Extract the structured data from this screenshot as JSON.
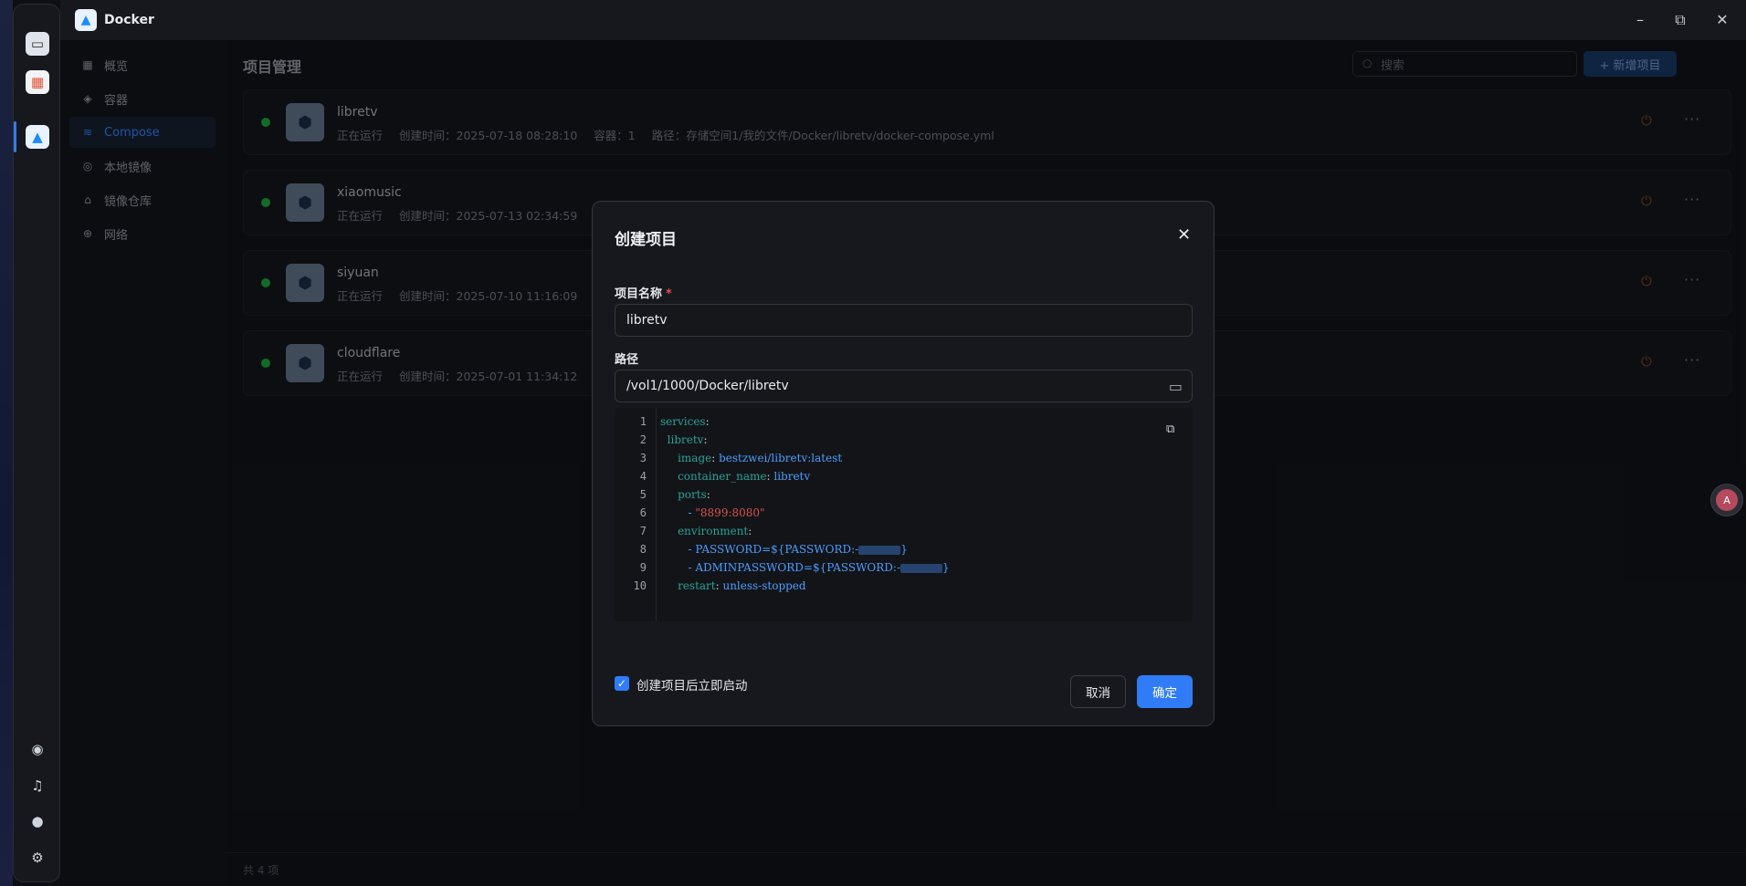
{
  "app": {
    "title": "Docker"
  },
  "window_controls": {
    "minimize": "–",
    "maximize": "⧉",
    "close": "✕"
  },
  "sidebar": {
    "items": [
      {
        "label": "概览",
        "icon": "grid-icon"
      },
      {
        "label": "容器",
        "icon": "box-icon"
      },
      {
        "label": "Compose",
        "icon": "layers-icon",
        "active": true
      },
      {
        "label": "本地镜像",
        "icon": "eye-icon"
      },
      {
        "label": "镜像仓库",
        "icon": "home-icon"
      },
      {
        "label": "网络",
        "icon": "globe-icon"
      }
    ]
  },
  "main": {
    "title": "项目管理",
    "search_placeholder": "搜索",
    "add_button": "+ 新增项目",
    "footer": "共 4 项",
    "projects": [
      {
        "name": "libretv",
        "status": "正在运行",
        "created": "创建时间：2025-07-18 08:28:10",
        "containers": "容器：1",
        "path": "路径：存储空间1/我的文件/Docker/libretv/docker-compose.yml"
      },
      {
        "name": "xiaomusic",
        "status": "正在运行",
        "created": "创建时间：2025-07-13 02:34:59"
      },
      {
        "name": "siyuan",
        "status": "正在运行",
        "created": "创建时间：2025-07-10 11:16:09"
      },
      {
        "name": "cloudflare",
        "status": "正在运行",
        "created": "创建时间：2025-07-01 11:34:12"
      }
    ]
  },
  "dialog": {
    "title": "创建项目",
    "name_label": "项目名称",
    "required_mark": "*",
    "name_value": "libretv",
    "path_label": "路径",
    "path_value": "/vol1/1000/Docker/libretv",
    "code_lines": [
      {
        "n": "1",
        "indent": "",
        "key": "services",
        "sep": ":",
        "val": ""
      },
      {
        "n": "2",
        "indent": "  ",
        "key": "libretv",
        "sep": ":",
        "val": ""
      },
      {
        "n": "3",
        "indent": "     ",
        "key": "image",
        "sep": ": ",
        "val": "bestzwei/libretv:latest"
      },
      {
        "n": "4",
        "indent": "     ",
        "key": "container_name",
        "sep": ": ",
        "val": "libretv"
      },
      {
        "n": "5",
        "indent": "     ",
        "key": "ports",
        "sep": ":",
        "val": ""
      },
      {
        "n": "6",
        "indent": "        ",
        "key": "",
        "sep": "- ",
        "str": "\"8899:8080\""
      },
      {
        "n": "7",
        "indent": "     ",
        "key": "environment",
        "sep": ":",
        "val": ""
      },
      {
        "n": "8",
        "indent": "        ",
        "key": "",
        "sep": "- ",
        "val": "PASSWORD=${PASSWORD:-",
        "masked": true
      },
      {
        "n": "9",
        "indent": "        ",
        "key": "",
        "sep": "- ",
        "val": "ADMINPASSWORD=${PASSWORD:-",
        "masked": true
      },
      {
        "n": "10",
        "indent": "     ",
        "key": "restart",
        "sep": ": ",
        "val": "unless-stopped"
      }
    ],
    "autostart_label": "创建项目后立即启动",
    "autostart_checked": true,
    "cancel_label": "取消",
    "ok_label": "确定"
  },
  "colors": {
    "accent": "#2f7cf6",
    "running": "#1b9e3a",
    "danger": "#e5484d"
  }
}
